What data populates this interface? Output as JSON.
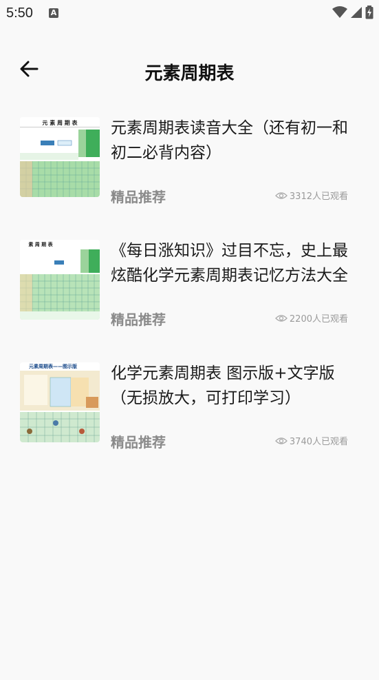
{
  "status_bar": {
    "time": "5:50",
    "notification_letter": "A"
  },
  "header": {
    "title": "元素周期表"
  },
  "items": [
    {
      "title": "元素周期表读音大全（还有初一和初二必背内容）",
      "tag": "精品推荐",
      "views": "3312人已观看"
    },
    {
      "title": "《每日涨知识》过目不忘，史上最炫酷化学元素周期表记忆方法大全",
      "tag": "精品推荐",
      "views": "2200人已观看"
    },
    {
      "title": "化学元素周期表 图示版+文字版（无损放大，可打印学习）",
      "tag": "精品推荐",
      "views": "3740人已观看"
    }
  ],
  "thumbs": [
    {
      "header_text": "元 素 周 期 表"
    },
    {
      "header_text": "素 周 期 表"
    },
    {
      "header_text": "元素周期表——图示版"
    }
  ]
}
